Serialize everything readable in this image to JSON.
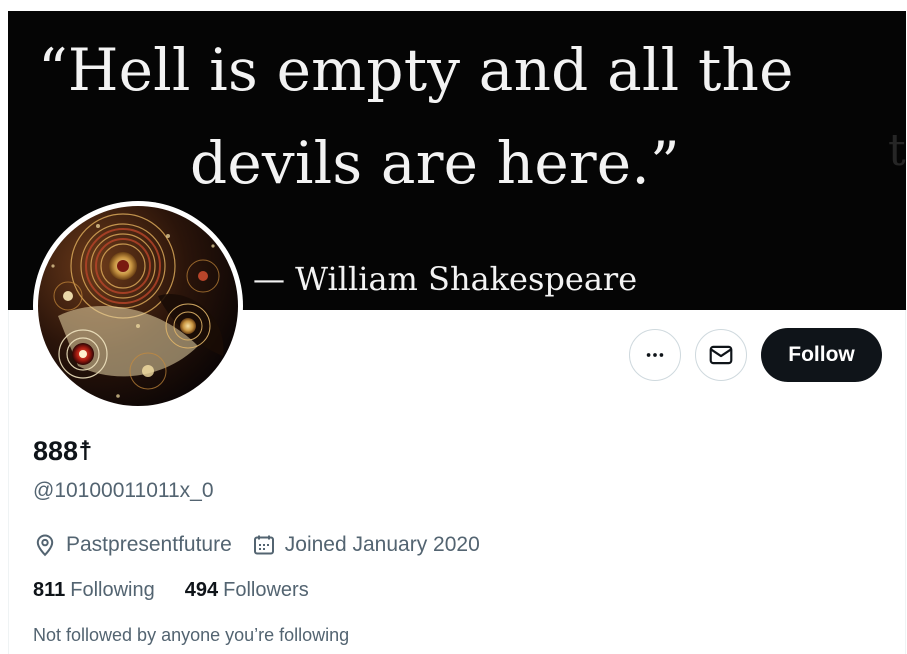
{
  "banner": {
    "quote_line_1": "“Hell is empty and all the",
    "quote_line_2": "devils are here.”",
    "attribution": "— William Shakespeare",
    "stray_glyph": "t",
    "background_color": "#050505",
    "text_color": "#f3f3f3"
  },
  "avatar": {
    "icon": "fractal-art-avatar"
  },
  "actions": {
    "more_icon": "more-horizontal-icon",
    "message_icon": "envelope-icon",
    "follow_label": "Follow"
  },
  "profile": {
    "display_name": "888☨",
    "handle": "@10100011011x_0",
    "location": "Pastpresentfuture",
    "location_icon": "location-pin-icon",
    "joined": "Joined January 2020",
    "joined_icon": "calendar-icon"
  },
  "stats": {
    "following_count": "811",
    "following_label": "Following",
    "followers_count": "494",
    "followers_label": "Followers"
  },
  "social_context": "Not followed by anyone you’re following",
  "colors": {
    "primary_text": "#0f1419",
    "secondary_text": "#536471",
    "follow_button_bg": "#0f1419",
    "border": "#cfd9de"
  }
}
